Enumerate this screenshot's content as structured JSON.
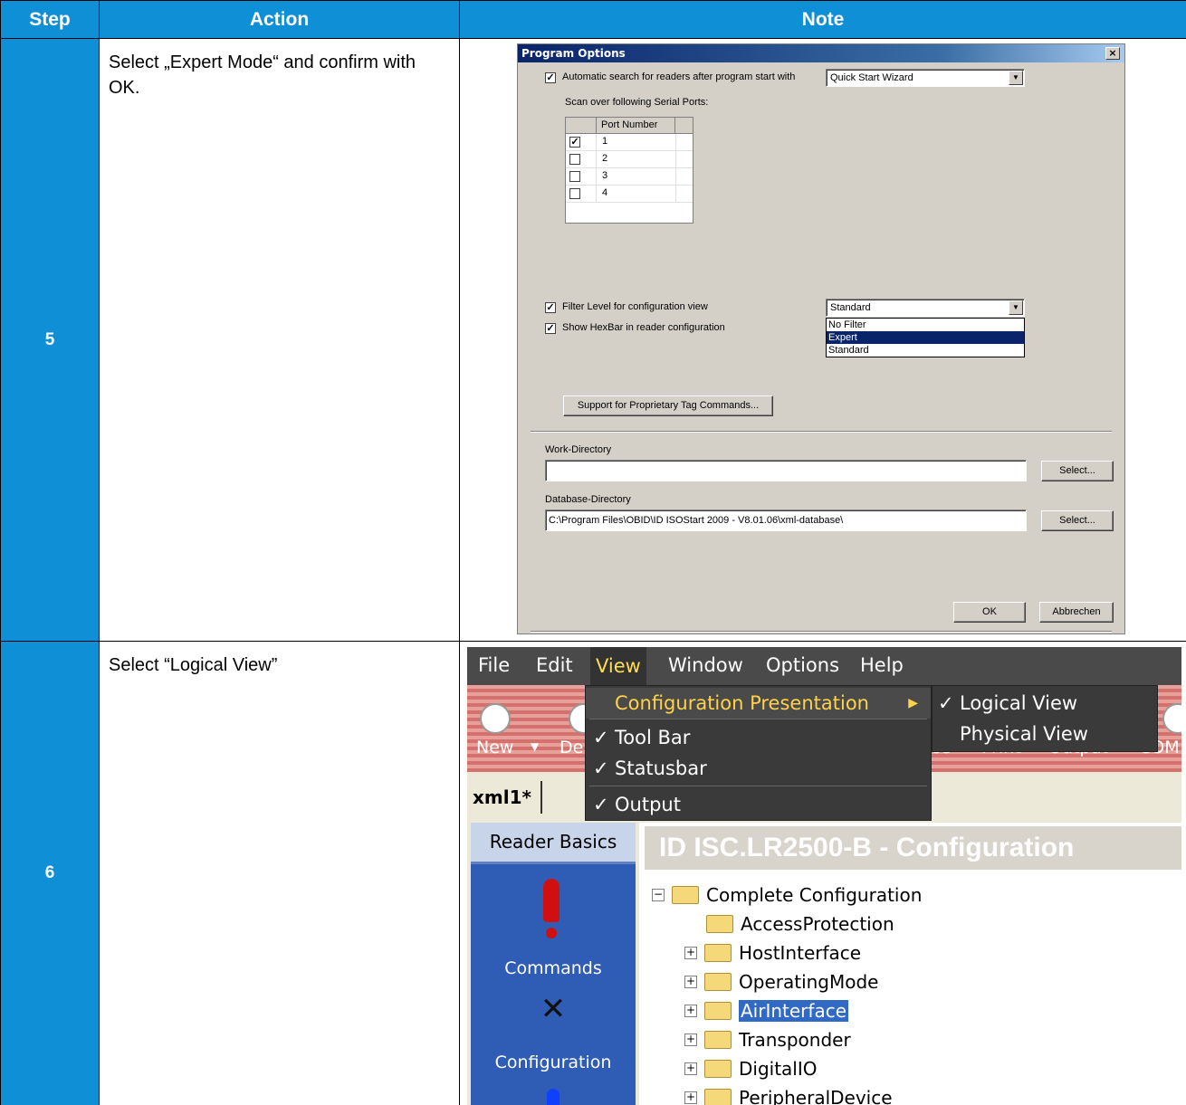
{
  "table": {
    "headers": [
      "Step",
      "Action",
      "Note"
    ],
    "rows": [
      {
        "step": "5",
        "action": "Select „Expert Mode“ and confirm with OK."
      },
      {
        "step": "6",
        "action": "Select “Logical View”"
      }
    ]
  },
  "dialog": {
    "title": "Program Options",
    "close_glyph": "×",
    "auto_search_label": "Automatic search for readers after program start with",
    "auto_search_combo": "Quick Start Wizard",
    "scan_ports_label": "Scan over following Serial Ports:",
    "port_column_header": "Port Number",
    "ports": [
      {
        "number": "1",
        "checked": true
      },
      {
        "number": "2",
        "checked": false
      },
      {
        "number": "3",
        "checked": false
      },
      {
        "number": "4",
        "checked": false
      }
    ],
    "filter_level_label": "Filter Level for configuration view",
    "filter_level_combo": "Standard",
    "filter_options": [
      "No Filter",
      "Expert",
      "Standard"
    ],
    "filter_selected": "Expert",
    "show_hexbar_label": "Show HexBar in reader configuration",
    "proprietary_button": "Support for Proprietary Tag Commands...",
    "work_dir_label": "Work-Directory",
    "work_dir_value": "",
    "db_dir_label": "Database-Directory",
    "db_dir_value": "C:\\Program Files\\OBID\\ID ISOStart 2009 - V8.01.06\\xml-database\\",
    "select_button": "Select...",
    "ok_button": "OK",
    "cancel_button": "Abbrechen"
  },
  "app": {
    "menubar": [
      "File",
      "Edit",
      "View",
      "Window",
      "Options",
      "Help"
    ],
    "active_menu": "View",
    "view_menu": [
      {
        "label": "Configuration Presentation",
        "has_submenu": true,
        "checked": false
      },
      {
        "label": "Tool Bar",
        "checked": true
      },
      {
        "label": "Statusbar",
        "checked": true
      },
      {
        "label": "Output",
        "checked": true
      }
    ],
    "submenu": [
      {
        "label": "Logical View",
        "checked": true
      },
      {
        "label": "Physical View",
        "checked": false
      }
    ],
    "toolbar_labels": [
      "New",
      "De",
      "ce",
      "Print",
      "Output",
      "COM"
    ],
    "tab_label": "xml1*",
    "sidebar_header": "Reader Basics",
    "sidebar_items": [
      "Commands",
      "Configuration"
    ],
    "title": "ID ISC.LR2500-B - Configuration",
    "tree": [
      {
        "label": "Complete Configuration",
        "expander": "−",
        "level": 0
      },
      {
        "label": "AccessProtection",
        "expander": "",
        "level": 1
      },
      {
        "label": "HostInterface",
        "expander": "+",
        "level": 1
      },
      {
        "label": "OperatingMode",
        "expander": "+",
        "level": 1
      },
      {
        "label": "AirInterface",
        "expander": "+",
        "level": 1,
        "selected": true
      },
      {
        "label": "Transponder",
        "expander": "+",
        "level": 1
      },
      {
        "label": "DigitalIO",
        "expander": "+",
        "level": 1
      },
      {
        "label": "PeripheralDevice",
        "expander": "+",
        "level": 1
      }
    ]
  }
}
